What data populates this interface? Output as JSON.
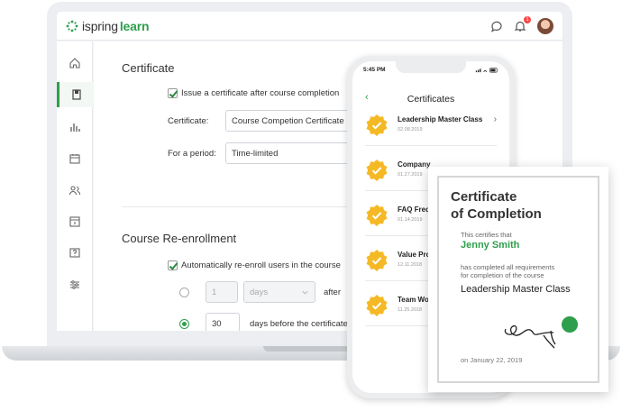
{
  "app": {
    "logo_brand": "ispring",
    "logo_product": "learn",
    "notification_count": "1"
  },
  "sidebar": {
    "items": [
      "home-icon",
      "courses-icon",
      "reports-icon",
      "calendar-icon",
      "users-icon",
      "info-icon",
      "help-icon",
      "settings-icon"
    ],
    "active": "courses-icon"
  },
  "certificate_section": {
    "title": "Certificate",
    "issue_checkbox_label": "Issue a certificate after course completion",
    "issue_checked": true,
    "certificate_label": "Certificate:",
    "certificate_value": "Course Competion Certificate",
    "period_label": "For a period:",
    "period_value": "Time-limited"
  },
  "reenroll_section": {
    "title": "Course Re-enrollment",
    "auto_checkbox_label": "Automatically re-enroll users in the course",
    "auto_checked": true,
    "option1_number": "1",
    "option1_unit": "days",
    "option1_suffix": "after",
    "option1_selected": false,
    "option2_number": "30",
    "option2_suffix": "days before the certificate",
    "option2_selected": true
  },
  "phone": {
    "time": "5:45 PM",
    "title": "Certificates",
    "back_symbol": "‹",
    "items": [
      {
        "name": "Leadership Master Class",
        "date": "02.08.2019",
        "chevron": "›"
      },
      {
        "name": "Company",
        "date": "01.27.2019",
        "chevron": ""
      },
      {
        "name": "FAQ Freq",
        "date": "01.14.2019",
        "chevron": ""
      },
      {
        "name": "Value Pro",
        "date": "12.11.2018",
        "chevron": ""
      },
      {
        "name": "Team Wo",
        "date": "11.25.2018",
        "chevron": ""
      }
    ]
  },
  "certificate_card": {
    "title_line1": "Certificate",
    "title_line2": "of Completion",
    "certifies": "This certifies that",
    "recipient": "Jenny Smith",
    "completed_line1": "has completed all requirements",
    "completed_line2": "for completion of the course",
    "course": "Leadership Master Class",
    "date": "on January 22, 2019"
  },
  "colors": {
    "brand_green": "#2e9f4c",
    "medal_gold": "#f5b926"
  }
}
